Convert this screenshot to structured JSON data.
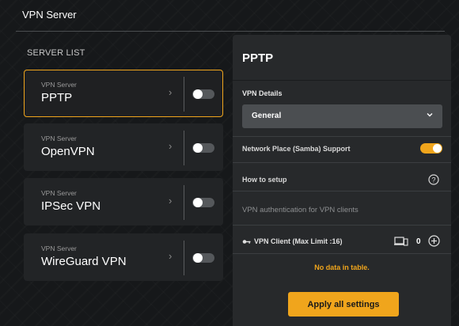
{
  "header": {
    "title": "VPN Server"
  },
  "server_list": {
    "label": "SERVER LIST",
    "items": [
      {
        "sub": "VPN Server",
        "name": "PPTP",
        "selected": true,
        "enabled": false
      },
      {
        "sub": "VPN Server",
        "name": "OpenVPN",
        "selected": false,
        "enabled": false
      },
      {
        "sub": "VPN Server",
        "name": "IPSec VPN",
        "selected": false,
        "enabled": false
      },
      {
        "sub": "VPN Server",
        "name": "WireGuard VPN",
        "selected": false,
        "enabled": false
      }
    ]
  },
  "panel": {
    "title": "PPTP",
    "details_label": "VPN Details",
    "details_value": "General",
    "samba_label": "Network Place (Samba) Support",
    "samba_enabled": true,
    "how_to_setup": "How to setup",
    "auth_label": "VPN authentication for VPN clients",
    "client_label": "VPN Client (Max Limit :16)",
    "client_count": "0",
    "no_data": "No data in table.",
    "apply_label": "Apply all settings"
  },
  "colors": {
    "accent": "#f0a51c",
    "background": "#16181a",
    "panel": "#27292b",
    "card": "#222426"
  },
  "icons": [
    "chevron-right-icon",
    "chevron-down-icon",
    "help-circle-icon",
    "key-icon",
    "device-icon",
    "add-circle-icon"
  ]
}
